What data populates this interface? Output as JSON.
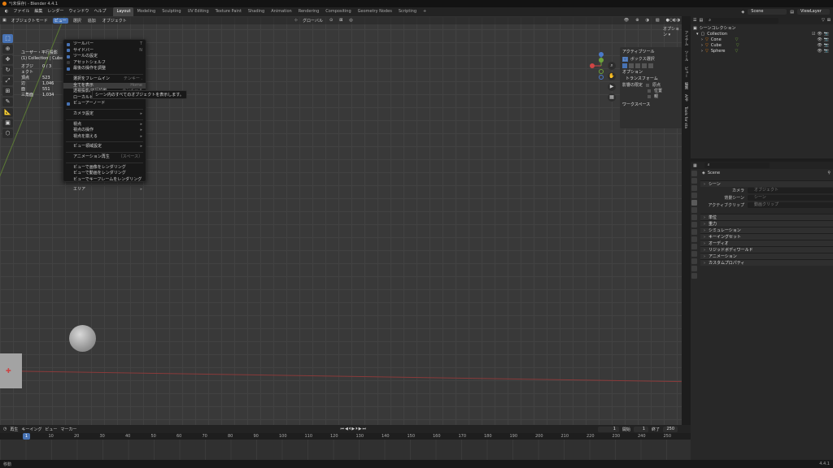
{
  "titlebar": {
    "title": "*(未保存) - Blender 4.4.1"
  },
  "menubar": {
    "menus": [
      "ファイル",
      "編集",
      "レンダー",
      "ウィンドウ",
      "ヘルプ"
    ],
    "workspaces": [
      "Layout",
      "Modeling",
      "Sculpting",
      "UV Editing",
      "Texture Paint",
      "Shading",
      "Animation",
      "Rendering",
      "Compositing",
      "Geometry Nodes",
      "Scripting"
    ],
    "active_workspace": "Layout",
    "add_tab": "+",
    "scene": "Scene",
    "view_layer": "ViewLayer"
  },
  "viewport_header": {
    "mode": "オブジェクトモード",
    "items": [
      "ビュー",
      "選択",
      "追加",
      "オブジェクト"
    ],
    "transform": "グローバル",
    "options": "オプション ▾"
  },
  "stats": {
    "title": "ユーザー・平行投影",
    "collection": "(1) Collection | Cube",
    "rows": [
      {
        "label": "オブジェクト",
        "value": "0 / 3"
      },
      {
        "label": "頂点",
        "value": "523"
      },
      {
        "label": "辺",
        "value": "1,046"
      },
      {
        "label": "面",
        "value": "551"
      },
      {
        "label": "三角面",
        "value": "1,034"
      }
    ]
  },
  "view_menu": {
    "items": [
      {
        "label": "ツールバー",
        "shortcut": "T",
        "check": true
      },
      {
        "label": "サイドバー",
        "shortcut": "N",
        "check": true
      },
      {
        "label": "ツールの設定",
        "shortcut": "",
        "check": true
      },
      {
        "label": "アセットシェルフ",
        "shortcut": "",
        "check": false
      },
      {
        "label": "最後の操作を調整",
        "shortcut": "",
        "check": true
      },
      {
        "label": "選択をフレームイン",
        "shortcut": "テンキー .",
        "sep": true
      },
      {
        "label": "全てを表示",
        "shortcut": "Home",
        "hl": true
      },
      {
        "label": "透視投影/平行投影",
        "shortcut": "テンキー 5"
      },
      {
        "label": "ローカルビュー",
        "shortcut": ""
      },
      {
        "label": "ビューアーノード",
        "shortcut": "",
        "check": true
      },
      {
        "label": "カメラ設定",
        "shortcut": "▸",
        "sep": true
      },
      {
        "label": "視点",
        "shortcut": "▸",
        "sep": true
      },
      {
        "label": "視点の操作",
        "shortcut": "▸"
      },
      {
        "label": "視点を揃える",
        "shortcut": "▸"
      },
      {
        "label": "ビュー領域設定",
        "shortcut": "▸",
        "sep": true
      },
      {
        "label": "アニメーション再生",
        "shortcut": "〔スペース〕",
        "sep": true
      },
      {
        "label": "ビューで画像をレンダリング",
        "shortcut": "",
        "sep": true
      },
      {
        "label": "ビューで動画をレンダリング",
        "shortcut": ""
      },
      {
        "label": "ビューでキーフレームをレンダリング",
        "shortcut": ""
      },
      {
        "label": "エリア",
        "shortcut": "▸",
        "sep": true
      }
    ]
  },
  "tooltip": "シーン内のすべてのオブジェクトを表示します。",
  "npanel": {
    "active_tool": "アクティブツール",
    "box_select": "ボックス選択",
    "options": "オプション",
    "transform": "トランスフォーム",
    "affect_only": "影響の限定",
    "origins": "原点",
    "locations": "位置",
    "parents": "親",
    "workspace": "ワークスペース"
  },
  "vertical_tabs": [
    "アイテム",
    "ツール",
    "ビュー",
    "編集",
    "APP",
    "Tools for sta"
  ],
  "outliner": {
    "search_placeholder": "",
    "root": "シーンコレクション",
    "collection": "Collection",
    "objects": [
      "Cone",
      "Cube",
      "Sphere"
    ]
  },
  "properties": {
    "scene_name": "Scene",
    "search_placeholder": "",
    "section_scene": "シーン",
    "camera_label": "カメラ",
    "camera_placeholder": "オブジェクト",
    "bg_label": "背景シーン",
    "bg_placeholder": "シーン",
    "clip_label": "アクティブクリップ",
    "clip_placeholder": "動画クリップ",
    "sections": [
      "単位",
      "重力",
      "シミュレーション",
      "キーイングセット",
      "オーディオ",
      "リジッドボディワールド",
      "アニメーション",
      "カスタムプロパティ"
    ]
  },
  "timeline": {
    "items": [
      "再生",
      "キーイング",
      "ビュー",
      "マーカー"
    ],
    "current_frame": "1",
    "start_label": "開始",
    "start": "1",
    "end_label": "終了",
    "end": "250",
    "ticks": [
      "1",
      "10",
      "20",
      "30",
      "40",
      "50",
      "60",
      "70",
      "80",
      "90",
      "100",
      "110",
      "120",
      "130",
      "140",
      "150",
      "160",
      "170",
      "180",
      "190",
      "200",
      "210",
      "220",
      "230",
      "240",
      "250"
    ]
  },
  "status": {
    "left": "移動",
    "right": "4.4.1"
  }
}
